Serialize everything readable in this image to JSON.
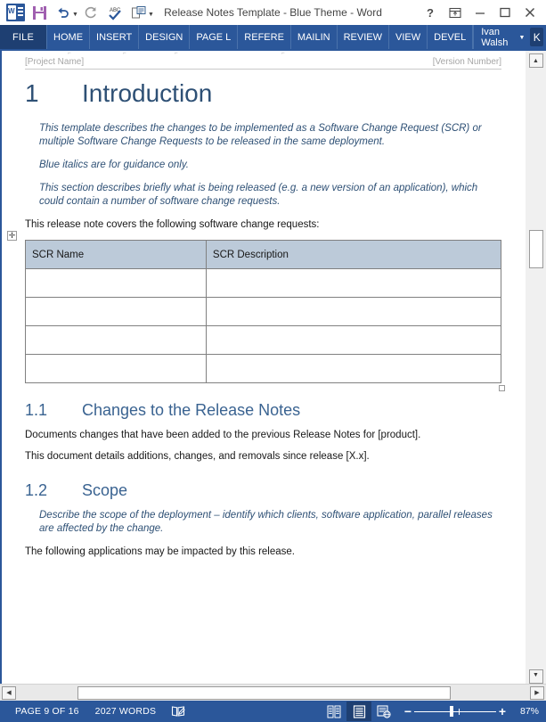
{
  "titlebar": {
    "title": "Release Notes Template - Blue Theme - Word",
    "quick_access": [
      {
        "name": "word-logo-icon",
        "label": "W"
      },
      {
        "name": "save-icon",
        "label": "Save"
      },
      {
        "name": "undo-icon",
        "label": "Undo"
      },
      {
        "name": "redo-icon",
        "label": "Redo"
      },
      {
        "name": "spelling-icon",
        "label": "ABC"
      },
      {
        "name": "print-preview-icon",
        "label": "Print Preview"
      },
      {
        "name": "customize-qat-icon",
        "label": "Customize Quick Access Toolbar"
      }
    ],
    "window_buttons": [
      {
        "name": "help-button",
        "glyph": "?"
      },
      {
        "name": "ribbon-display-options-button",
        "glyph": "⊡"
      },
      {
        "name": "minimize-button",
        "glyph": "–"
      },
      {
        "name": "maximize-button",
        "glyph": "□"
      },
      {
        "name": "close-button",
        "glyph": "✕"
      }
    ]
  },
  "ribbon": {
    "file_tab": "FILE",
    "tabs": [
      "HOME",
      "INSERT",
      "DESIGN",
      "PAGE L",
      "REFERE",
      "MAILIN",
      "REVIEW",
      "VIEW",
      "DEVEL"
    ],
    "user_name": "Ivan Walsh",
    "avatar_initial": "K"
  },
  "document": {
    "header_left": "[Project Name]",
    "header_right": "[Version Number]",
    "heading1": {
      "number": "1",
      "text": "Introduction"
    },
    "intro_guidance": [
      "This template describes the changes to be implemented as a Software Change Request (SCR) or multiple Software Change Requests to be released in the same deployment.",
      "Blue italics are for guidance only.",
      "This section describes briefly what is being released (e.g. a new version of an application), which could contain a number of software change requests."
    ],
    "intro_body": "This release note covers the following software change requests:",
    "scr_table": {
      "headers": [
        "SCR Name",
        "SCR Description"
      ],
      "rows": [
        [
          "",
          ""
        ],
        [
          "",
          ""
        ],
        [
          "",
          ""
        ],
        [
          "",
          ""
        ]
      ]
    },
    "heading_1_1": {
      "number": "1.1",
      "text": "Changes to the Release Notes"
    },
    "section_1_1_body": [
      "Documents changes that have been added to the previous Release Notes for [product].",
      "This document details additions, changes, and removals since release [X.x]."
    ],
    "heading_1_2": {
      "number": "1.2",
      "text": "Scope"
    },
    "section_1_2_guidance": "Describe the scope of the deployment – identify which clients, software application, parallel releases are affected by the change.",
    "section_1_2_body": "The following applications may be impacted by this release."
  },
  "statusbar": {
    "page_info": "PAGE 9 OF 16",
    "word_count": "2027 WORDS",
    "proofing_icon": "proofing-errors-icon",
    "views": [
      {
        "name": "read-mode-view-button",
        "label": "Read Mode",
        "active": false
      },
      {
        "name": "print-layout-view-button",
        "label": "Print Layout",
        "active": true
      },
      {
        "name": "web-layout-view-button",
        "label": "Web Layout",
        "active": false
      }
    ],
    "zoom_out": "−",
    "zoom_in": "+",
    "zoom_level": "87%"
  },
  "colors": {
    "ribbon_blue": "#2b579a",
    "file_tab_blue": "#1e3f72",
    "heading_blue": "#2e5075",
    "subheading_blue": "#3a6391",
    "table_header_fill": "#bccad9",
    "guidance_italic_blue": "#2e5075"
  }
}
